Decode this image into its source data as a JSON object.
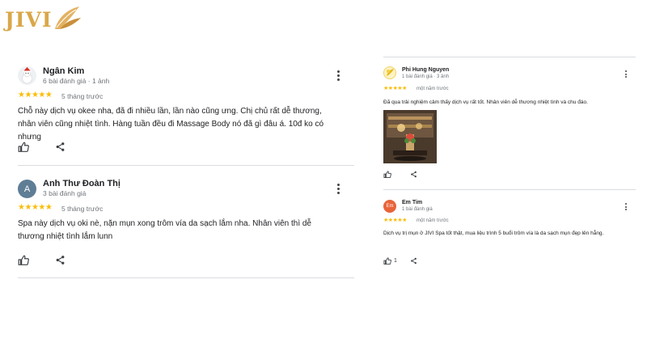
{
  "logo": {
    "text": "JIVI"
  },
  "colors": {
    "star": "#fbbc04",
    "avatar_gray": "#5f7d95",
    "avatar_orange": "#e8633a",
    "divider": "#dadce0"
  },
  "reviews_left": [
    {
      "name": "Ngân Kim",
      "meta": "6 bài đánh giá · 1 ảnh",
      "stars": 5,
      "time": "5 tháng trước",
      "text": "Chỗ này dịch vụ okee nha, đã đi nhiều lần, lần nào cũng ưng. Chị chủ rất dễ thương, nhân viên cũng nhiệt tình. Hàng tuần đều đi Massage Body nó đã gì đâu á. 10đ ko có nhưng",
      "avatar_icon": "snowman-avatar-icon"
    },
    {
      "name": "Anh Thư Đoàn Thị",
      "meta": "3 bài đánh giá",
      "stars": 5,
      "time": "5 tháng trước",
      "text": "Spa này dịch vụ oki nè, nặn mụn xong trôm vía da sạch lắm nha. Nhân viên thì dễ thương nhiệt tình lắm lunn",
      "avatar_letter": "A"
    }
  ],
  "reviews_right": [
    {
      "name": "Phi Hung Nguyen",
      "meta": "1 bài đánh giá · 3 ảnh",
      "stars": 5,
      "time": "một năm trước",
      "text": "Đã qua trải nghiệm cảm thấy dịch vụ rất tốt. Nhân viên dễ thương nhiệt tình và chu đáo.",
      "avatar_icon": "yellow-logo-avatar-icon"
    },
    {
      "name": "Em Tim",
      "meta": "1 bài đánh giá",
      "stars": 5,
      "time": "một năm trước",
      "text": "Dịch vụ trị mụn ở JIVI Spa tốt thật, mua liệu trình 5 buổi trôm vía là da sạch mụn đẹp lên hẳng.",
      "avatar_letter": "Em",
      "like_count": "1"
    }
  ],
  "icons": {
    "like": "thumb-up-icon",
    "share": "share-icon",
    "more": "more-vert-icon",
    "star": "star-icon"
  }
}
